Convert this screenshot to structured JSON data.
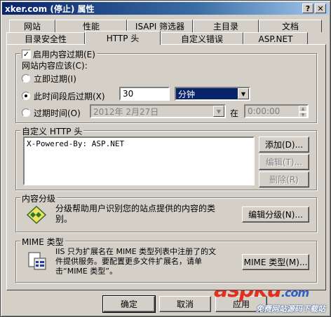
{
  "window": {
    "title": "xker.com (停止) 属性",
    "help": "?",
    "close": "✕"
  },
  "tabs_row1": [
    "网站",
    "性能",
    "ISAPI 筛选器",
    "主目录",
    "文档"
  ],
  "tabs_row2": [
    "目录安全性",
    "HTTP 头",
    "自定义错误",
    "ASP.NET"
  ],
  "active_tab": "HTTP 头",
  "expire": {
    "checkbox_label": "启用内容过期(E)",
    "checked": true,
    "subtitle": "网站内容应该(C):",
    "opt_now": "立即过期(I)",
    "opt_after": "此时间段后过期(X)",
    "after_value": "30",
    "after_unit": "分钟",
    "opt_on": "过期时间(O)",
    "date_value": "2012年  2月27日",
    "at_label": "在",
    "time_value": "0:00:00"
  },
  "custom_headers": {
    "title": "自定义 HTTP 头",
    "items": [
      "X-Powered-By: ASP.NET"
    ],
    "add": "添加(D)...",
    "edit": "编辑(T)...",
    "delete": "删除(R)"
  },
  "rating": {
    "title": "内容分级",
    "desc": "分级帮助用户识别您的站点提供的内容的类别。",
    "edit": "编辑分级(N)..."
  },
  "mime": {
    "title": "MIME 类型",
    "desc": "IIS 只为扩展名在 MIME 类型列表中注册了的文件提供服务。要配置更多文件扩展名，请单击“MIME 类型”。",
    "button": "MIME 类型(M)..."
  },
  "footer": {
    "ok": "确定",
    "cancel": "取消",
    "apply": "应用"
  },
  "watermark": {
    "brand": "aspku",
    "suffix": ".com",
    "tagline": "免费网站源码下载站"
  }
}
